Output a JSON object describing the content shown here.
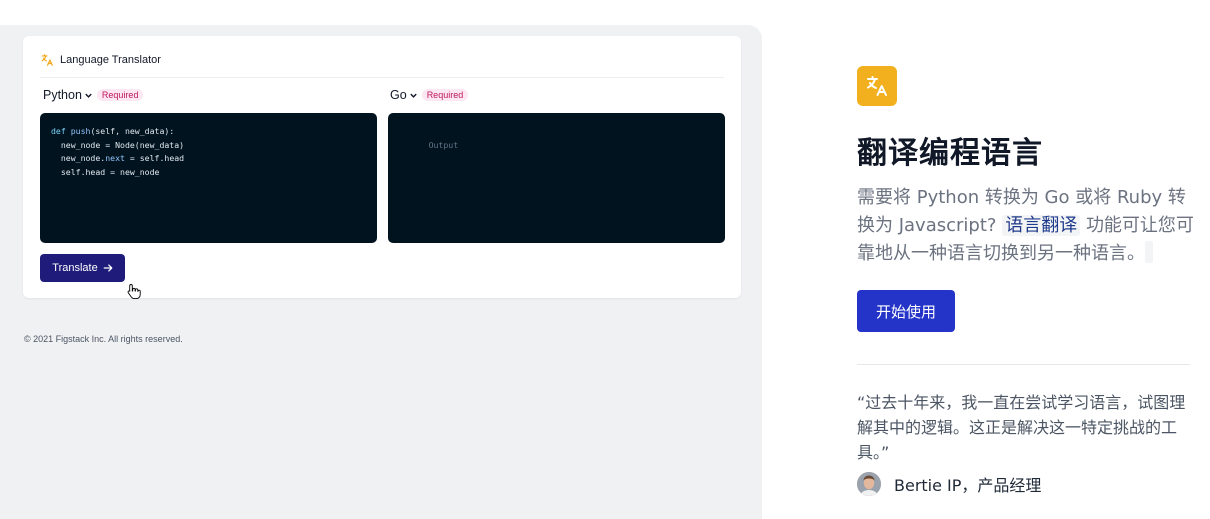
{
  "translator": {
    "title": "Language Translator",
    "source_lang": "Python",
    "target_lang": "Go",
    "required_label": "Required",
    "code_lines": [
      [
        {
          "t": "def ",
          "c": "kw"
        },
        {
          "t": "push",
          "c": "fn"
        },
        {
          "t": "(self, new_data):",
          "c": ""
        }
      ],
      [
        {
          "t": "  new_node = Node(new_data)",
          "c": ""
        }
      ],
      [
        {
          "t": "  new_node.",
          "c": ""
        },
        {
          "t": "next",
          "c": "fn"
        },
        {
          "t": " = self.head",
          "c": ""
        }
      ],
      [
        {
          "t": "  self.head = new_node",
          "c": ""
        }
      ]
    ],
    "output_placeholder": "Output",
    "translate_label": "Translate",
    "footer": "© 2021 Figstack Inc. All rights reserved."
  },
  "feature": {
    "title": "翻译编程语言",
    "desc_before": "需要将 Python 转换为 Go 或将 Ruby 转换为 Javascript?",
    "desc_highlight": "语言翻译",
    "desc_after": "功能可让您可靠地从一种语言切换到另一种语言。",
    "cta_label": "开始使用",
    "quote": "“过去十年来，我一直在尝试学习语言，试图理解其中的逻辑。这正是解决这一特定挑战的工具。”",
    "author": "Bertie IP，产品经理"
  },
  "colors": {
    "accent": "#2434c8",
    "icon_bg": "#f2b01e",
    "code_bg": "#00131f",
    "translate_button": "#1e1b7a"
  },
  "icons": {
    "feature": "translate-icon",
    "header": "translate-icon",
    "button": "arrow-right-icon"
  }
}
